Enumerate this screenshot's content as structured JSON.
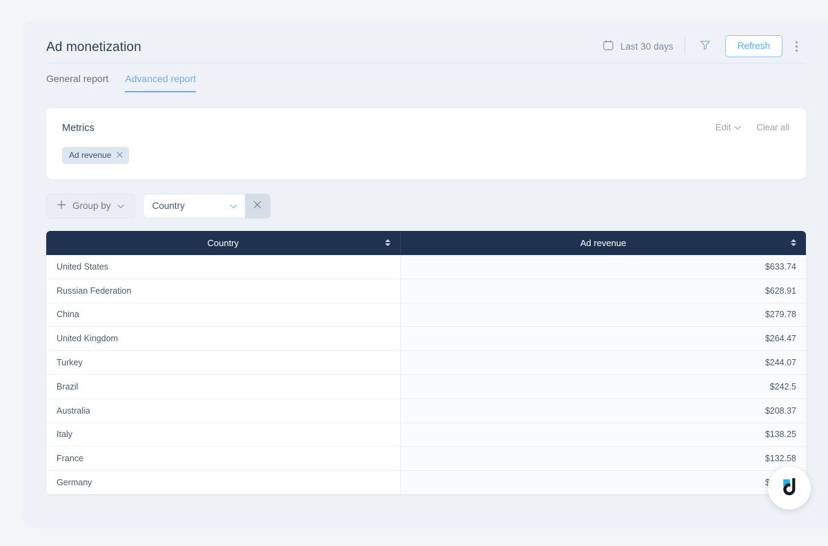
{
  "header": {
    "title": "Ad monetization",
    "date_range_label": "Last 30 days",
    "calendar_icon": "calendar-icon",
    "filter_icon": "filter-funnel-icon",
    "refresh_label": "Refresh",
    "kebab_icon": "more-vertical-icon"
  },
  "tabs": [
    {
      "label": "General report",
      "active": false
    },
    {
      "label": "Advanced report",
      "active": true
    }
  ],
  "metrics": {
    "title": "Metrics",
    "edit_label": "Edit",
    "edit_chevron_icon": "chevron-down-icon",
    "clear_all_label": "Clear all",
    "chips": [
      {
        "label": "Ad revenue",
        "remove_icon": "close-x-icon"
      }
    ]
  },
  "group_by": {
    "add_icon": "plus-icon",
    "button_label": "Group by",
    "button_chevron_icon": "chevron-down-icon",
    "select_value": "Country",
    "select_chevron_icon": "chevron-down-icon",
    "clear_icon": "close-x-icon"
  },
  "table": {
    "columns": [
      {
        "label": "Country",
        "sort_icon": "sort-updown-icon"
      },
      {
        "label": "Ad revenue",
        "sort_icon": "sort-updown-icon"
      }
    ],
    "rows": [
      {
        "country": "United States",
        "revenue": "$633.74"
      },
      {
        "country": "Russian Federation",
        "revenue": "$628.91"
      },
      {
        "country": "China",
        "revenue": "$279.78"
      },
      {
        "country": "United Kingdom",
        "revenue": "$264.47"
      },
      {
        "country": "Turkey",
        "revenue": "$244.07"
      },
      {
        "country": "Brazil",
        "revenue": "$242.5"
      },
      {
        "country": "Australia",
        "revenue": "$208.37"
      },
      {
        "country": "Italy",
        "revenue": "$138.25"
      },
      {
        "country": "France",
        "revenue": "$132.58"
      },
      {
        "country": "Germany",
        "revenue": "$129.59"
      }
    ]
  },
  "chat_widget": {
    "icon": "devtodev-d-logo-icon"
  },
  "colors": {
    "accent_blue": "#6aaef2",
    "table_header_navy": "#1f3350",
    "chip_bg": "#dde7f1",
    "logo_cyan": "#12b5f0",
    "page_bg": "#f4f5f7",
    "panel_bg": "#eef2f6"
  }
}
